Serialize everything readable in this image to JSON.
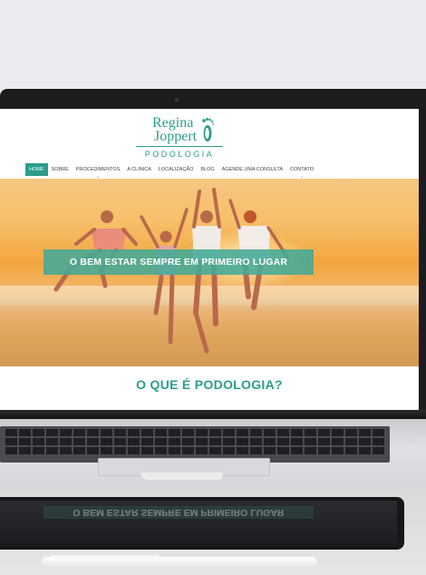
{
  "site": {
    "logo": {
      "name_line1": "Regina",
      "name_line2": "Joppert",
      "tagline": "PODOLOGIA"
    },
    "nav": [
      {
        "label": "HOME",
        "active": true,
        "has_dropdown": false
      },
      {
        "label": "SOBRE",
        "active": false,
        "has_dropdown": false
      },
      {
        "label": "PROCEDIMENTOS",
        "active": false,
        "has_dropdown": true
      },
      {
        "label": "A CLÍNICA",
        "active": false,
        "has_dropdown": false
      },
      {
        "label": "LOCALIZAÇÃO",
        "active": false,
        "has_dropdown": false
      },
      {
        "label": "BLOG",
        "active": false,
        "has_dropdown": false
      },
      {
        "label": "AGENDE UMA CONSULTA",
        "active": false,
        "has_dropdown": false
      },
      {
        "label": "CONTATO",
        "active": false,
        "has_dropdown": true
      }
    ],
    "hero": {
      "banner_text": "O BEM ESTAR SEMPRE EM PRIMEIRO LUGAR"
    },
    "section_title": "O QUE É PODOLOGIA?"
  },
  "colors": {
    "brand_teal": "#2b9d8a",
    "banner_teal": "#43aa96",
    "bezel": "#1c1c1e"
  },
  "icons": [
    "footprint-icon",
    "chevron-down-icon"
  ]
}
